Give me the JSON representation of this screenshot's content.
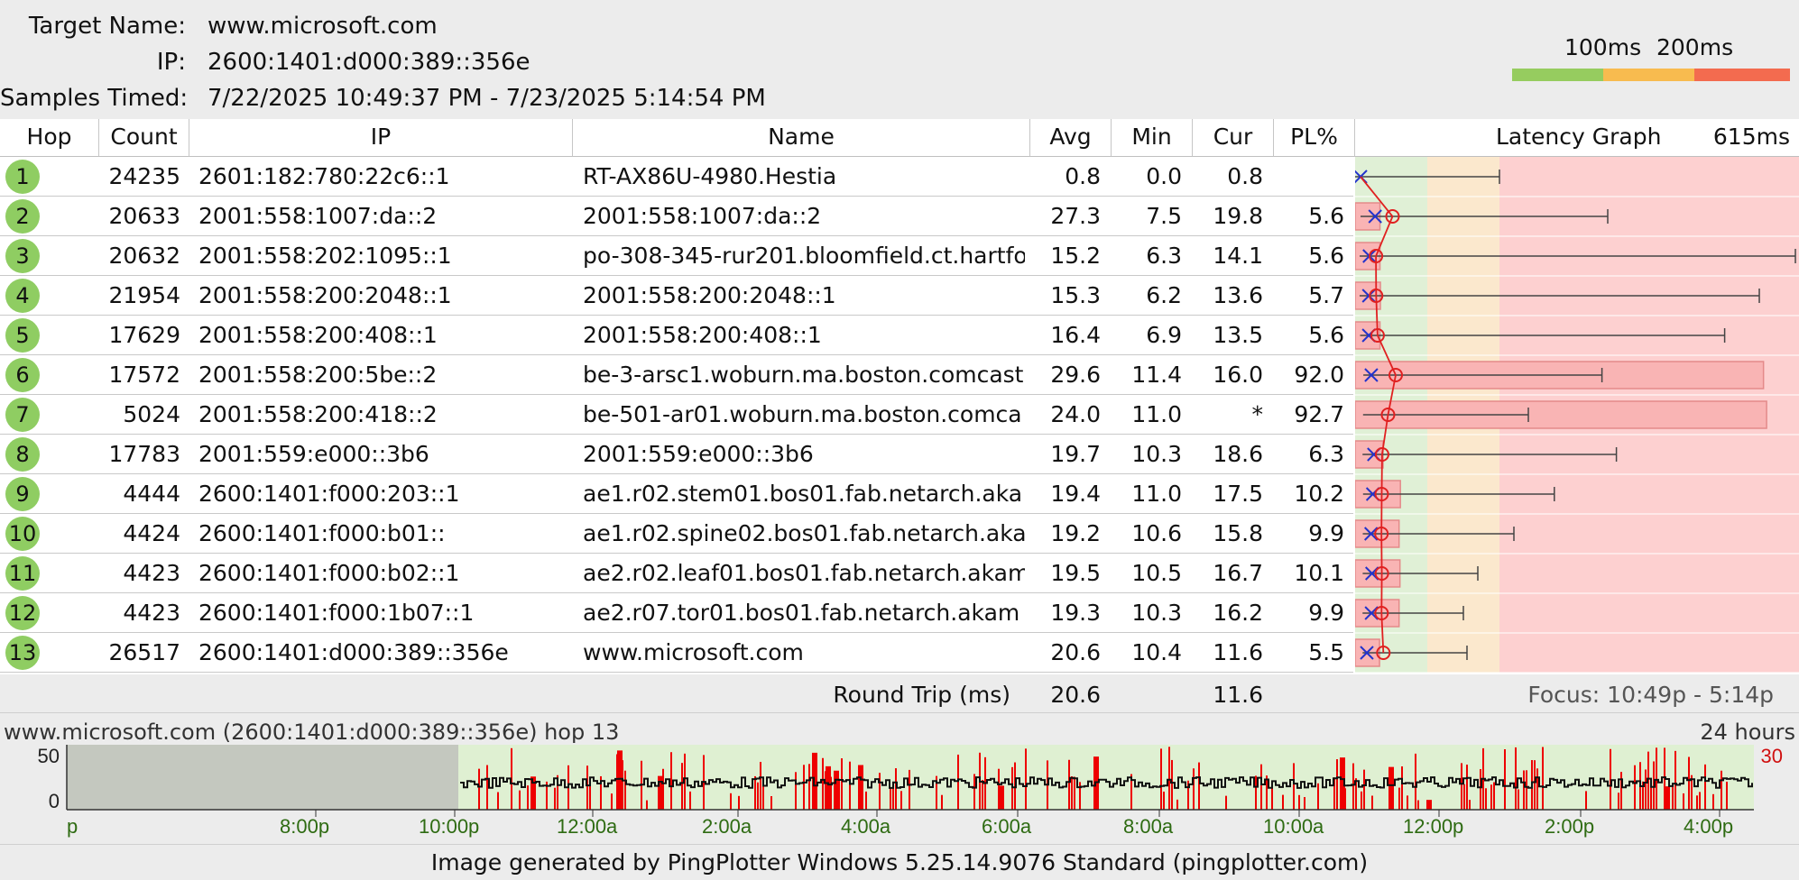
{
  "header": {
    "target_label": "Target Name:",
    "target_value": "www.microsoft.com",
    "ip_label": "IP:",
    "ip_value": "2600:1401:d000:389::356e",
    "samples_label": "Samples Timed:",
    "samples_value": "7/22/2025 10:49:37 PM - 7/23/2025 5:14:54 PM"
  },
  "legend": {
    "label_100": "100ms",
    "label_200": "200ms",
    "colors": {
      "good": "#96cc5f",
      "warn": "#f8bb4f",
      "bad": "#f36b4f"
    }
  },
  "columns": {
    "hop": "Hop",
    "count": "Count",
    "ip": "IP",
    "name": "Name",
    "avg": "Avg",
    "min": "Min",
    "cur": "Cur",
    "pl": "PL%",
    "graph": "Latency Graph",
    "graph_max": "615ms"
  },
  "hops": [
    {
      "hop": "1",
      "count": "24235",
      "ip": "2601:182:780:22c6::1",
      "name": "RT-AX86U-4980.Hestia",
      "avg": "0.8",
      "min": "0.0",
      "cur": "0.8",
      "pl": "",
      "avg_ms": 0.8,
      "min_ms": 0.0,
      "cur_ms": 0.8,
      "max_ms": 200,
      "pl_value": 0
    },
    {
      "hop": "2",
      "count": "20633",
      "ip": "2001:558:1007:da::2",
      "name": "2001:558:1007:da::2",
      "avg": "27.3",
      "min": "7.5",
      "cur": "19.8",
      "pl": "5.6",
      "avg_ms": 27.3,
      "min_ms": 7.5,
      "cur_ms": 19.8,
      "max_ms": 350,
      "pl_value": 5.6
    },
    {
      "hop": "3",
      "count": "20632",
      "ip": "2001:558:202:1095::1",
      "name": "po-308-345-rur201.bloomfield.ct.hartfo",
      "avg": "15.2",
      "min": "6.3",
      "cur": "14.1",
      "pl": "5.6",
      "avg_ms": 15.2,
      "min_ms": 6.3,
      "cur_ms": 14.1,
      "max_ms": 610,
      "pl_value": 5.6
    },
    {
      "hop": "4",
      "count": "21954",
      "ip": "2001:558:200:2048::1",
      "name": "2001:558:200:2048::1",
      "avg": "15.3",
      "min": "6.2",
      "cur": "13.6",
      "pl": "5.7",
      "avg_ms": 15.3,
      "min_ms": 6.2,
      "cur_ms": 13.6,
      "max_ms": 560,
      "pl_value": 5.7
    },
    {
      "hop": "5",
      "count": "17629",
      "ip": "2001:558:200:408::1",
      "name": "2001:558:200:408::1",
      "avg": "16.4",
      "min": "6.9",
      "cur": "13.5",
      "pl": "5.6",
      "avg_ms": 16.4,
      "min_ms": 6.9,
      "cur_ms": 13.5,
      "max_ms": 512,
      "pl_value": 5.6
    },
    {
      "hop": "6",
      "count": "17572",
      "ip": "2001:558:200:5be::2",
      "name": "be-3-arsc1.woburn.ma.boston.comcast.",
      "avg": "29.6",
      "min": "11.4",
      "cur": "16.0",
      "pl": "92.0",
      "avg_ms": 29.6,
      "min_ms": 11.4,
      "cur_ms": 16.0,
      "max_ms": 342,
      "pl_value": 92.0
    },
    {
      "hop": "7",
      "count": "5024",
      "ip": "2001:558:200:418::2",
      "name": "be-501-ar01.woburn.ma.boston.comca",
      "avg": "24.0",
      "min": "11.0",
      "cur": "*",
      "pl": "92.7",
      "avg_ms": 24.0,
      "min_ms": 11.0,
      "cur_ms": null,
      "max_ms": 240,
      "pl_value": 92.7
    },
    {
      "hop": "8",
      "count": "17783",
      "ip": "2001:559:e000::3b6",
      "name": "2001:559:e000::3b6",
      "avg": "19.7",
      "min": "10.3",
      "cur": "18.6",
      "pl": "6.3",
      "avg_ms": 19.7,
      "min_ms": 10.3,
      "cur_ms": 18.6,
      "max_ms": 362,
      "pl_value": 6.3
    },
    {
      "hop": "9",
      "count": "4444",
      "ip": "2600:1401:f000:203::1",
      "name": "ae1.r02.stem01.bos01.fab.netarch.aka",
      "avg": "19.4",
      "min": "11.0",
      "cur": "17.5",
      "pl": "10.2",
      "avg_ms": 19.4,
      "min_ms": 11.0,
      "cur_ms": 17.5,
      "max_ms": 276,
      "pl_value": 10.2
    },
    {
      "hop": "10",
      "count": "4424",
      "ip": "2600:1401:f000:b01::",
      "name": "ae1.r02.spine02.bos01.fab.netarch.aka",
      "avg": "19.2",
      "min": "10.6",
      "cur": "15.8",
      "pl": "9.9",
      "avg_ms": 19.2,
      "min_ms": 10.6,
      "cur_ms": 15.8,
      "max_ms": 220,
      "pl_value": 9.9
    },
    {
      "hop": "11",
      "count": "4423",
      "ip": "2600:1401:f000:b02::1",
      "name": "ae2.r02.leaf01.bos01.fab.netarch.akam",
      "avg": "19.5",
      "min": "10.5",
      "cur": "16.7",
      "pl": "10.1",
      "avg_ms": 19.5,
      "min_ms": 10.5,
      "cur_ms": 16.7,
      "max_ms": 170,
      "pl_value": 10.1
    },
    {
      "hop": "12",
      "count": "4423",
      "ip": "2600:1401:f000:1b07::1",
      "name": "ae2.r07.tor01.bos01.fab.netarch.akam",
      "avg": "19.3",
      "min": "10.3",
      "cur": "16.2",
      "pl": "9.9",
      "avg_ms": 19.3,
      "min_ms": 10.3,
      "cur_ms": 16.2,
      "max_ms": 150,
      "pl_value": 9.9
    },
    {
      "hop": "13",
      "count": "26517",
      "ip": "2600:1401:d000:389::356e",
      "name": "www.microsoft.com",
      "avg": "20.6",
      "min": "10.4",
      "cur": "11.6",
      "pl": "5.5",
      "avg_ms": 20.6,
      "min_ms": 10.4,
      "cur_ms": 11.6,
      "max_ms": 155,
      "pl_value": 5.5
    }
  ],
  "round_trip": {
    "label": "Round Trip (ms)",
    "avg": "20.6",
    "cur": "11.6",
    "focus": "Focus: 10:49p - 5:14p"
  },
  "timeline": {
    "title": "www.microsoft.com (2600:1401:d000:389::356e) hop 13",
    "range": "24 hours",
    "y_ticks": [
      "50",
      "0"
    ],
    "right_value": "30",
    "x_labels": [
      "8:00p",
      "10:00p",
      "12:00a",
      "2:00a",
      "4:00a",
      "6:00a",
      "8:00a",
      "10:00a",
      "12:00p",
      "2:00p",
      "4:00p"
    ],
    "left_edge_label": "p"
  },
  "footer": "Image generated by PingPlotter Windows 5.25.14.9076 Standard (pingplotter.com)"
}
